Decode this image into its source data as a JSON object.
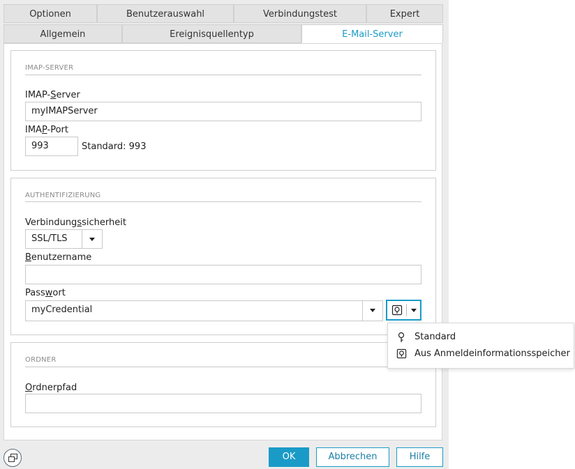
{
  "tabs_row1": [
    "Optionen",
    "Benutzerauswahl",
    "Verbindungstest",
    "Expert"
  ],
  "tabs_row2": [
    "Allgemein",
    "Ereignisquellentyp",
    "E-Mail-Server"
  ],
  "imap": {
    "title": "IMAP-SERVER",
    "server_label_pre": "IMAP-",
    "server_label_u": "S",
    "server_label_post": "erver",
    "server_value": "myIMAPServer",
    "port_label_pre": "IMA",
    "port_label_u": "P",
    "port_label_post": "-Port",
    "port_value": "993",
    "port_standard": "Standard: 993"
  },
  "auth": {
    "title": "AUTHENTIFIZIERUNG",
    "security_label_pre": "Verbindung",
    "security_label_u": "s",
    "security_label_post": "sicherheit",
    "security_value": "SSL/TLS",
    "user_label_u": "B",
    "user_label_post": "enutzername",
    "user_value": "",
    "password_label_pre": "Pass",
    "password_label_u": "w",
    "password_label_post": "ort",
    "password_value": "myCredential"
  },
  "folder": {
    "title": "ORDNER",
    "path_label_u": "O",
    "path_label_post": "rdnerpfad",
    "path_value": ""
  },
  "popup": {
    "items": [
      {
        "label": "Standard",
        "icon": "key-icon"
      },
      {
        "label": "Aus Anmeldeinformationsspeicher",
        "icon": "credential-safe-icon"
      }
    ]
  },
  "buttons": {
    "ok": "OK",
    "cancel": "Abbrechen",
    "help": "Hilfe"
  },
  "colors": {
    "accent": "#1a9bc7",
    "dialog_bg": "#ececec"
  }
}
